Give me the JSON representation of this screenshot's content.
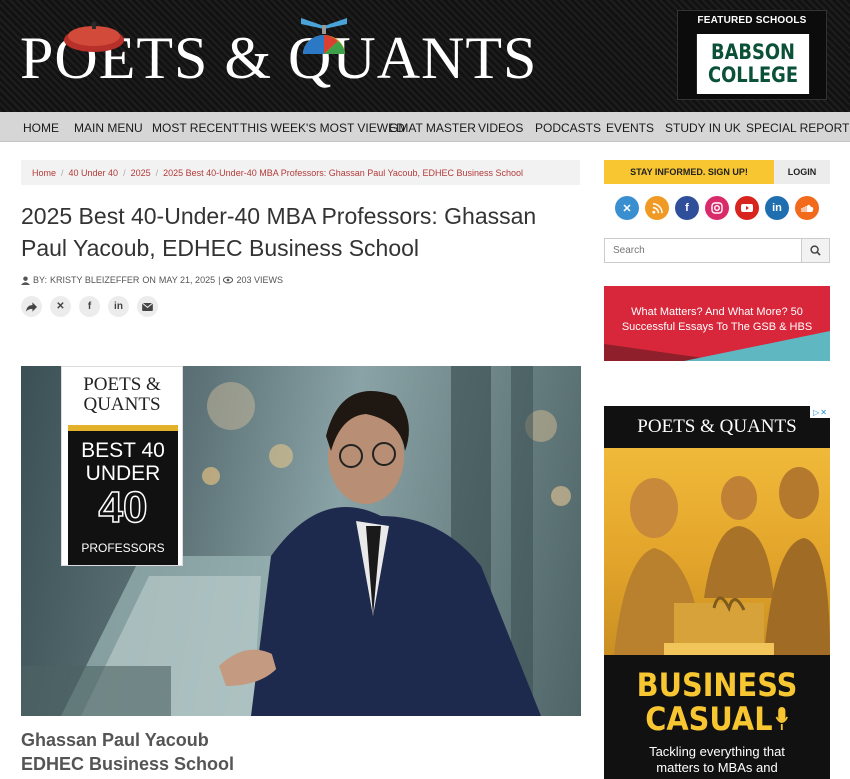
{
  "site": {
    "logo_text": "POETS & QUANTS",
    "featured_title": "FEATURED SCHOOLS",
    "featured_school_line1": "BABSON",
    "featured_school_line2": "COLLEGE"
  },
  "nav": {
    "items": [
      "HOME",
      "MAIN MENU",
      "MOST RECENT",
      "THIS WEEK'S MOST VIEWED",
      "GMAT MASTER",
      "VIDEOS",
      "PODCASTS",
      "EVENTS",
      "STUDY IN UK",
      "SPECIAL REPORTS"
    ]
  },
  "breadcrumb": [
    "Home",
    "40 Under 40",
    "2025",
    "2025 Best 40-Under-40 MBA Professors: Ghassan Paul Yacoub, EDHEC Business School"
  ],
  "article": {
    "title": "2025 Best 40-Under-40 MBA Professors: Ghassan Paul Yacoub, EDHEC Business School",
    "meta_by": "BY:",
    "author": "KRISTY BLEIZEFFER",
    "meta_on": "ON",
    "date": "MAY 21, 2025",
    "views": "203 VIEWS",
    "caption_name": "Ghassan Paul Yacoub",
    "caption_school": "EDHEC Business School"
  },
  "badge": {
    "brand_line1": "POETS &",
    "brand_line2": "QUANTS",
    "line1": "BEST 40",
    "line2": "UNDER",
    "number": "40",
    "line4": "PROFESSORS"
  },
  "sidebar": {
    "signup_label": "STAY INFORMED. SIGN UP!",
    "login_label": "LOGIN",
    "search_placeholder": "Search",
    "ad1_text": "What Matters? And What More? 50 Successful Essays To The GSB & HBS",
    "ad2_logo": "POETS & QUANTS",
    "ad2_headline_1": "BUSINESS",
    "ad2_headline_2": "CASUAL",
    "ad2_sub_1": "Tackling everything that",
    "ad2_sub_2": "matters to MBAs and"
  },
  "colors": {
    "accent_yellow": "#f8c630",
    "link_red": "#b33a3a",
    "babson_green": "#0b5138"
  },
  "social_icons": [
    "x-icon",
    "rss-icon",
    "facebook-icon",
    "instagram-icon",
    "youtube-icon",
    "linkedin-icon",
    "soundcloud-icon"
  ]
}
